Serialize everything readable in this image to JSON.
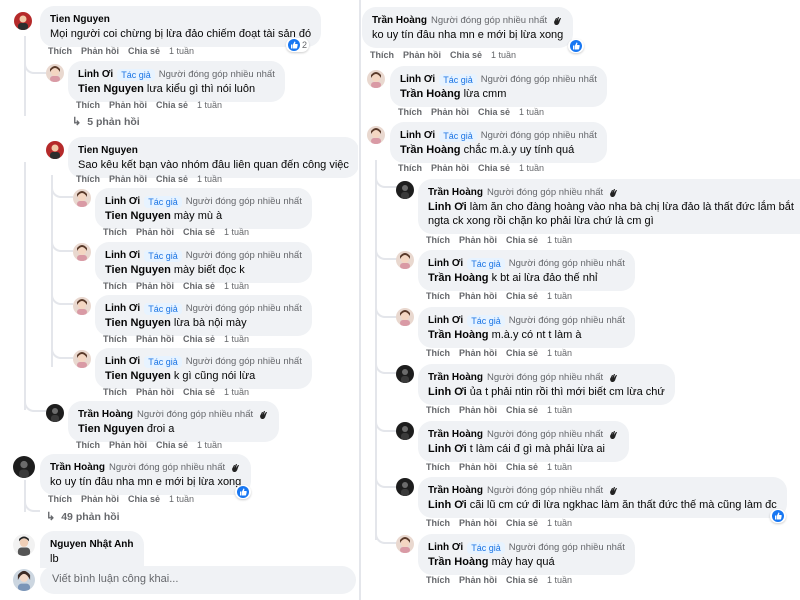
{
  "common": {
    "like": "Thích",
    "reply": "Phản hồi",
    "share": "Chia sẻ",
    "author_badge": "Tác giả",
    "top_fan_tag": "Người đóng góp nhiều nhất"
  },
  "left": {
    "c1": {
      "author": "Tien Nguyen",
      "text": "Mọi người coi chừng bị lừa đảo chiếm đoạt tài sản đó",
      "time": "1 tuần",
      "reaction_count": "2"
    },
    "c2": {
      "author": "Linh Ơi",
      "mention": "Tien Nguyen",
      "text": "lưa kiểu gì thì nói luôn",
      "time": "1 tuần"
    },
    "replies1": "5 phản hồi",
    "c3": {
      "author": "Tien Nguyen",
      "text": "Sao kêu kết bạn vào nhóm đâu liên quan đến công việc",
      "time": "1 tuần"
    },
    "c4": {
      "author": "Linh Ơi",
      "mention": "Tien Nguyen",
      "text": "mày mù à",
      "time": "1 tuần"
    },
    "c5": {
      "author": "Linh Ơi",
      "mention": "Tien Nguyen",
      "text": "mày biết đọc k",
      "time": "1 tuần"
    },
    "c6": {
      "author": "Linh Ơi",
      "mention": "Tien Nguyen",
      "text": "lừa bà nội mày",
      "time": "1 tuần"
    },
    "c7": {
      "author": "Linh Ơi",
      "mention": "Tien Nguyen",
      "text": "k gì cũng nói lừa",
      "time": "1 tuần"
    },
    "c8": {
      "author": "Trần Hoàng",
      "mention": "Tien Nguyen",
      "text": "đroi a",
      "time": "1 tuần"
    },
    "c9": {
      "author": "Trần Hoàng",
      "text": "ko uy tín đâu nha mn e mới bị lừa xong",
      "time": "1 tuần"
    },
    "replies2": "49 phản hồi",
    "c10": {
      "author": "Nguyen Nhật Anh",
      "text": "lb"
    },
    "write_placeholder": "Viết bình luận công khai..."
  },
  "right": {
    "r1": {
      "author": "Trần Hoàng",
      "text": "ko uy tín đâu nha mn e mới bị lừa xong",
      "time": "1 tuần"
    },
    "r2": {
      "author": "Linh Ơi",
      "mention": "Trần Hoàng",
      "text": "lừa cmm",
      "time": "1 tuần"
    },
    "r3": {
      "author": "Linh Ơi",
      "mention": "Trần Hoàng",
      "text": "chắc m.à.y uy tính quá",
      "time": "1 tuần"
    },
    "r4": {
      "author": "Trần Hoàng",
      "text1": "làm ăn cho đàng hoàng vào nha bà chị lừa đảo là thất đức lắm bắt",
      "text2": "ngta ck xong rồi chặn ko phải lừa chứ là cm gì",
      "mention": "Linh Ơi",
      "time": "1 tuần"
    },
    "r5": {
      "author": "Linh Ơi",
      "mention": "Trần Hoàng",
      "text": "k bt ai lừa đảo thế nhỉ",
      "time": "1 tuần"
    },
    "r6": {
      "author": "Linh Ơi",
      "mention": "Trần Hoàng",
      "text": "m.à.y có nt t làm à",
      "time": "1 tuần"
    },
    "r7": {
      "author": "Trần Hoàng",
      "mention": "Linh Ơi",
      "text": "ủa t phải ntin rồi thì mới biết cm lừa chứ",
      "time": "1 tuần"
    },
    "r8": {
      "author": "Trần Hoàng",
      "mention": "Linh Ơi",
      "text": "t làm cái đ gì mà phải lừa ai",
      "time": "1 tuần"
    },
    "r9": {
      "author": "Trần Hoàng",
      "mention": "Linh Ơi",
      "text": "cãi lũ cm cứ đi lừa ngkhac làm ăn thất đức thế mà cũng làm đc",
      "time": "1 tuần"
    },
    "r10": {
      "author": "Linh Ơi",
      "mention": "Trần Hoàng",
      "text": "mày hay quá",
      "time": "1 tuần"
    }
  },
  "colors": {
    "link": "#1b74e4",
    "meta": "#65676b",
    "bubble": "#f0f2f5",
    "like_blue": "#1877f2"
  },
  "icons": [
    "wave-icon",
    "like-icon",
    "reply-arrow-icon",
    "avatar"
  ]
}
